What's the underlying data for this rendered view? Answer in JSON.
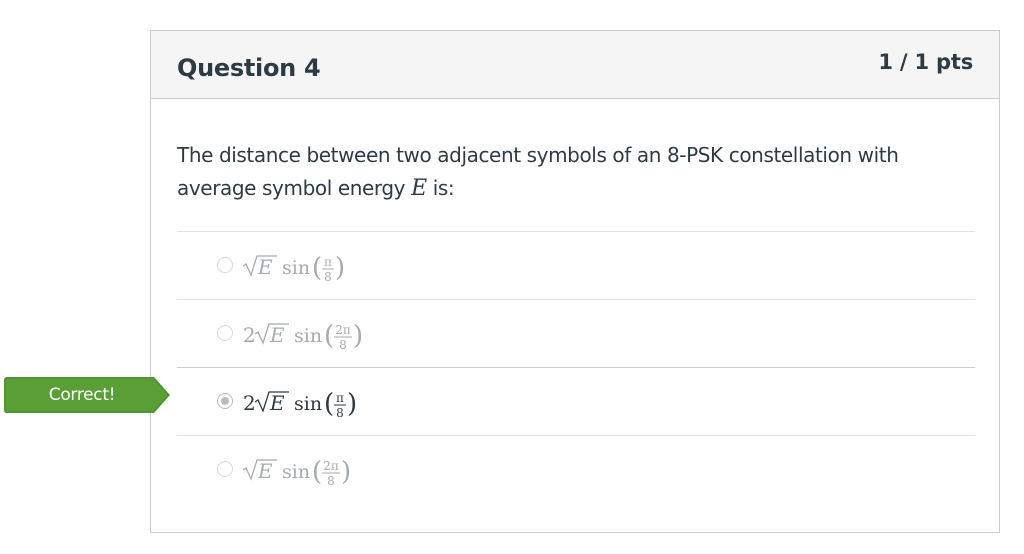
{
  "question": {
    "title": "Question 4",
    "points": "1 / 1 pts",
    "text_before": "The distance between two adjacent symbols of an 8-PSK constellation with average symbol energy ",
    "variable": "E",
    "text_after": " is:"
  },
  "feedback": {
    "label": "Correct!",
    "color": "#5a9f36"
  },
  "answers": [
    {
      "coefficient": "",
      "radicand": "E",
      "function": "sin",
      "numerator": "π",
      "denominator": "8",
      "selected": false,
      "correct": false
    },
    {
      "coefficient": "2",
      "radicand": "E",
      "function": "sin",
      "numerator": "2π",
      "denominator": "8",
      "selected": false,
      "correct": false
    },
    {
      "coefficient": "2",
      "radicand": "E",
      "function": "sin",
      "numerator": "π",
      "denominator": "8",
      "selected": true,
      "correct": true
    },
    {
      "coefficient": "",
      "radicand": "E",
      "function": "sin",
      "numerator": "2π",
      "denominator": "8",
      "selected": false,
      "correct": false
    }
  ],
  "colors": {
    "text": "#2d3b45",
    "muted": "#a5abaf",
    "selected_text": "#2d3b45",
    "header_bg": "#f5f5f5",
    "border": "#c7cdd1"
  }
}
